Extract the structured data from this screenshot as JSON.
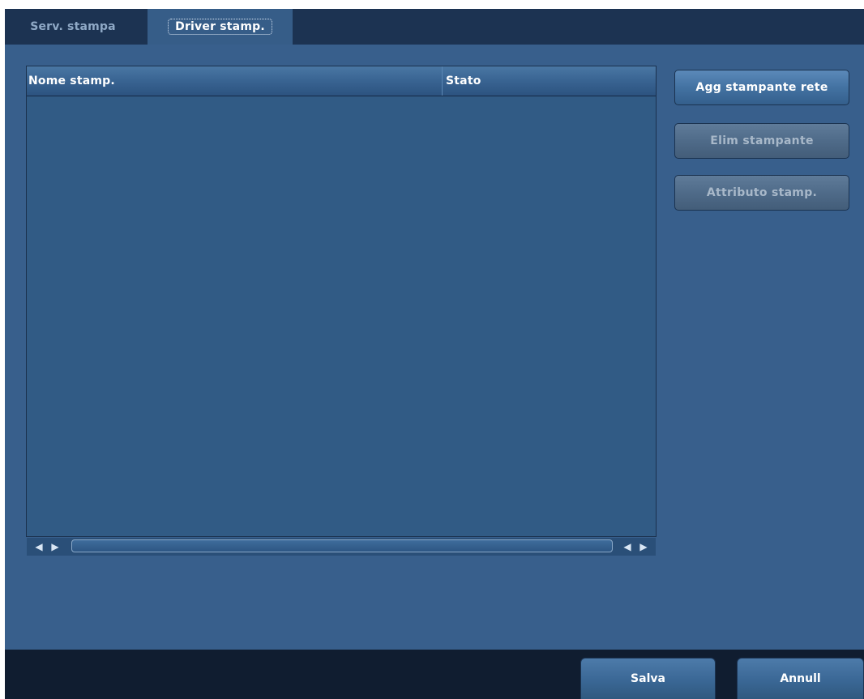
{
  "tabs": [
    {
      "label": "Serv. stampa",
      "active": false
    },
    {
      "label": "Driver stamp.",
      "active": true
    }
  ],
  "printer_list": {
    "columns": [
      "Nome stamp.",
      "Stato"
    ],
    "rows": []
  },
  "actions": {
    "add_network_printer": "Agg stampante rete",
    "delete_printer": "Elim stampante",
    "printer_attributes": "Attributo stamp."
  },
  "footer": {
    "save_label": "Salva",
    "cancel_label": "Annull"
  },
  "icons": {
    "scroll_left": "left-arrow-icon",
    "scroll_right": "right-arrow-icon"
  },
  "colors": {
    "background": "#385f8c",
    "tabbar": "#1c3352",
    "footer": "#101d30"
  }
}
